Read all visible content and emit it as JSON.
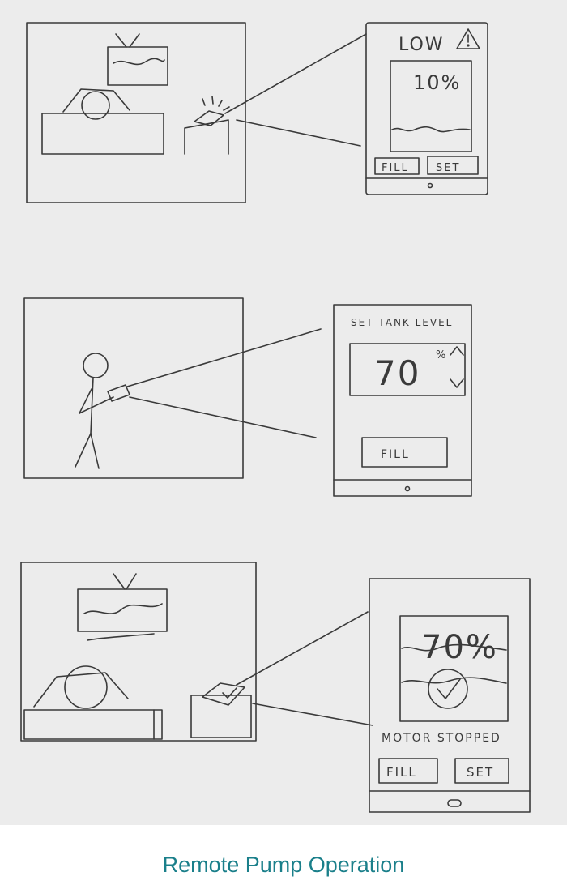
{
  "caption": "Remote Pump Operation",
  "colors": {
    "caption": "#1a7f8a",
    "pencil": "#3a3a3a",
    "paper": "#ececec"
  },
  "panel1": {
    "status": "LOW",
    "level": "10%",
    "fill_label": "FILL",
    "set_label": "SET"
  },
  "panel2": {
    "title": "SET TANK LEVEL",
    "level_value": "70",
    "level_unit": "%",
    "fill_label": "FILL"
  },
  "panel3": {
    "level": "70%",
    "status": "MOTOR STOPPED",
    "fill_label": "FILL",
    "set_label": "SET"
  }
}
